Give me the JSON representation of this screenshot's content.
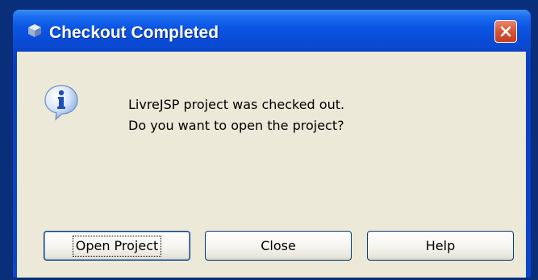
{
  "window": {
    "title": "Checkout Completed"
  },
  "dialog": {
    "message_line1": "LivreJSP project was checked out.",
    "message_line2": "Do you want to open the project?",
    "icon": "info-icon"
  },
  "buttons": {
    "open_project": "Open Project",
    "close": "Close",
    "help": "Help"
  },
  "colors": {
    "title_bar": "#0a4bd6",
    "client_bg": "#ece9d8",
    "close_button": "#d9573a"
  }
}
